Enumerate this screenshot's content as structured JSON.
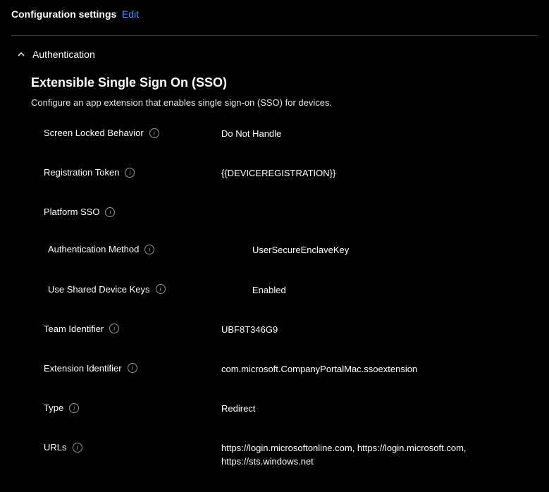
{
  "header": {
    "title": "Configuration settings",
    "edit_label": "Edit"
  },
  "section": {
    "name": "Authentication",
    "title": "Extensible Single Sign On (SSO)",
    "description": "Configure an app extension that enables single sign-on (SSO) for devices."
  },
  "fields": {
    "screen_locked": {
      "label": "Screen Locked Behavior",
      "value": "Do Not Handle"
    },
    "registration_token": {
      "label": "Registration Token",
      "value": "{{DEVICEREGISTRATION}}"
    },
    "platform_sso": {
      "label": "Platform SSO",
      "auth_method": {
        "label": "Authentication Method",
        "value": "UserSecureEnclaveKey"
      },
      "shared_keys": {
        "label": "Use Shared Device Keys",
        "value": "Enabled"
      }
    },
    "team_identifier": {
      "label": "Team Identifier",
      "value": "UBF8T346G9"
    },
    "extension_identifier": {
      "label": "Extension Identifier",
      "value": "com.microsoft.CompanyPortalMac.ssoextension"
    },
    "type": {
      "label": "Type",
      "value": "Redirect"
    },
    "urls": {
      "label": "URLs",
      "value": "https://login.microsoftonline.com, https://login.microsoft.com, https://sts.windows.net"
    }
  }
}
